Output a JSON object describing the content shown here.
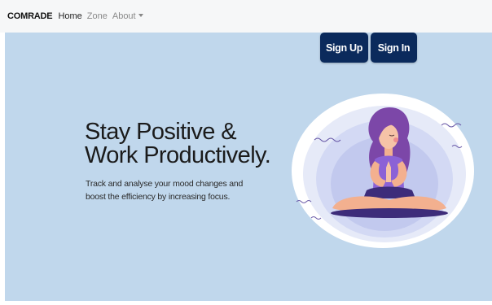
{
  "navbar": {
    "brand": "COMRADE",
    "items": [
      {
        "label": "Home"
      },
      {
        "label": "Zone"
      },
      {
        "label": "About"
      }
    ]
  },
  "hero": {
    "buttons": {
      "signup": "Sign Up",
      "signin": "Sign In"
    },
    "headline_line1": "Stay Positive &",
    "headline_line2": "Work Productively.",
    "subtext": "Track and analyse your mood changes and boost the efficiency by increasing focus.",
    "illustration": "meditating-woman-illustration"
  },
  "colors": {
    "navbar_bg": "#f6f7f8",
    "hero_bg": "#c0d7ec",
    "button_bg": "#0b2a5c",
    "button_text": "#ffffff",
    "headline_text": "#1b1b1b"
  }
}
